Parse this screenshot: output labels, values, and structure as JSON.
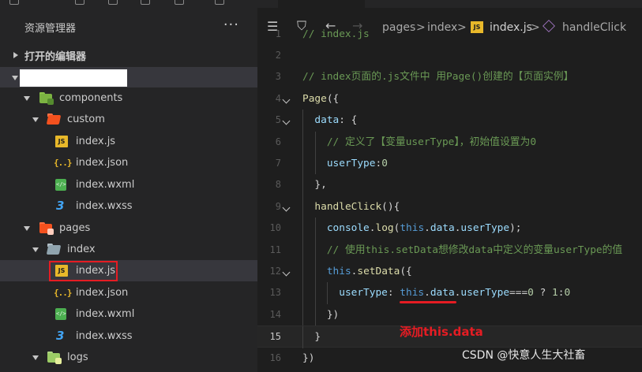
{
  "sidebar": {
    "title": "资源管理器",
    "more_glyph": "···",
    "open_editors_label": "打开的编辑器",
    "tree": [
      {
        "label": "components",
        "kind": "folder-special"
      },
      {
        "label": "custom",
        "kind": "folder-open-red"
      },
      {
        "label": "index.js",
        "kind": "js"
      },
      {
        "label": "index.json",
        "kind": "json"
      },
      {
        "label": "index.wxml",
        "kind": "wxml"
      },
      {
        "label": "index.wxss",
        "kind": "wxss"
      },
      {
        "label": "pages",
        "kind": "folder-red"
      },
      {
        "label": "index",
        "kind": "folder-open-gray"
      },
      {
        "label": "index.js",
        "kind": "js",
        "selected": true
      },
      {
        "label": "index.json",
        "kind": "json"
      },
      {
        "label": "index.wxml",
        "kind": "wxml"
      },
      {
        "label": "index.wxss",
        "kind": "wxss"
      },
      {
        "label": "logs",
        "kind": "folder-plain"
      }
    ],
    "icon_glyphs": {
      "js": "JS",
      "json": "{..}",
      "wxss": "3"
    }
  },
  "editor": {
    "breadcrumb": {
      "segments": [
        "pages",
        "index",
        "index.js",
        "handleClick"
      ],
      "separator": ">",
      "icons": [
        "list-icon",
        "bookmark-icon",
        "back-arrow-icon",
        "forward-arrow-icon"
      ],
      "js_badge": "JS"
    },
    "lines": [
      {
        "num": "1",
        "code": "// index.js"
      },
      {
        "num": "2",
        "code": ""
      },
      {
        "num": "3",
        "code": "// index页面的.js文件中 用Page()创建的【页面实例】"
      },
      {
        "num": "4",
        "code": "Page({"
      },
      {
        "num": "5",
        "code": "  data: {"
      },
      {
        "num": "6",
        "code": "    // 定义了【变量userType】，初始值设置为0"
      },
      {
        "num": "7",
        "code": "    userType:0"
      },
      {
        "num": "8",
        "code": "  },"
      },
      {
        "num": "9",
        "code": "  handleClick(){"
      },
      {
        "num": "10",
        "code": "    console.log(this.data.userType);"
      },
      {
        "num": "11",
        "code": "    // 使用this.setData想修改data中定义的变量userType的值"
      },
      {
        "num": "12",
        "code": "    this.setData({"
      },
      {
        "num": "13",
        "code": "      userType: this.data.userType===0 ? 1:0"
      },
      {
        "num": "14",
        "code": "    })"
      },
      {
        "num": "15",
        "code": "  }"
      },
      {
        "num": "16",
        "code": "})"
      }
    ],
    "current_line": "15"
  },
  "annotation": {
    "text": "添加this.data",
    "color": "#e51c23"
  },
  "watermark": "CSDN @快意人生大社畜",
  "colors": {
    "sidebar_bg": "#252526",
    "editor_bg": "#1e1e1e",
    "selection": "#37373d",
    "highlight_red": "#e51c23",
    "comment": "#6a9955",
    "function": "#dcdcaa",
    "property": "#9cdcfe",
    "keyword_this": "#569cd6",
    "number": "#b5cea8"
  }
}
